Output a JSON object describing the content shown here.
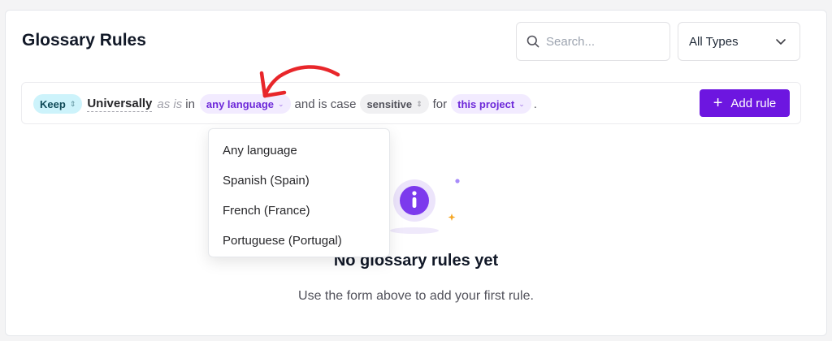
{
  "header": {
    "title": "Glossary Rules",
    "search": {
      "placeholder": "Search...",
      "value": ""
    },
    "type_filter": {
      "selected": "All Types"
    }
  },
  "rule_builder": {
    "action": "Keep",
    "term": "Universally",
    "as_is": "as is",
    "in": "in",
    "language": "any language",
    "and_case": "and is case",
    "case": "sensitive",
    "for": "for",
    "scope": "this project",
    "period": ".",
    "add_button": "Add rule"
  },
  "language_dropdown": {
    "options": [
      "Any language",
      "Spanish (Spain)",
      "French (France)",
      "Portuguese (Portugal)"
    ]
  },
  "empty_state": {
    "title": "No glossary rules yet",
    "subtitle": "Use the form above to add your first rule."
  },
  "colors": {
    "accent": "#6d16e0",
    "keep_chip": "#cdf3fb",
    "annotation_arrow": "#e8262a"
  },
  "icons": [
    "search-icon",
    "chevron-down-icon",
    "plus-icon",
    "info-icon",
    "annotation-arrow"
  ]
}
